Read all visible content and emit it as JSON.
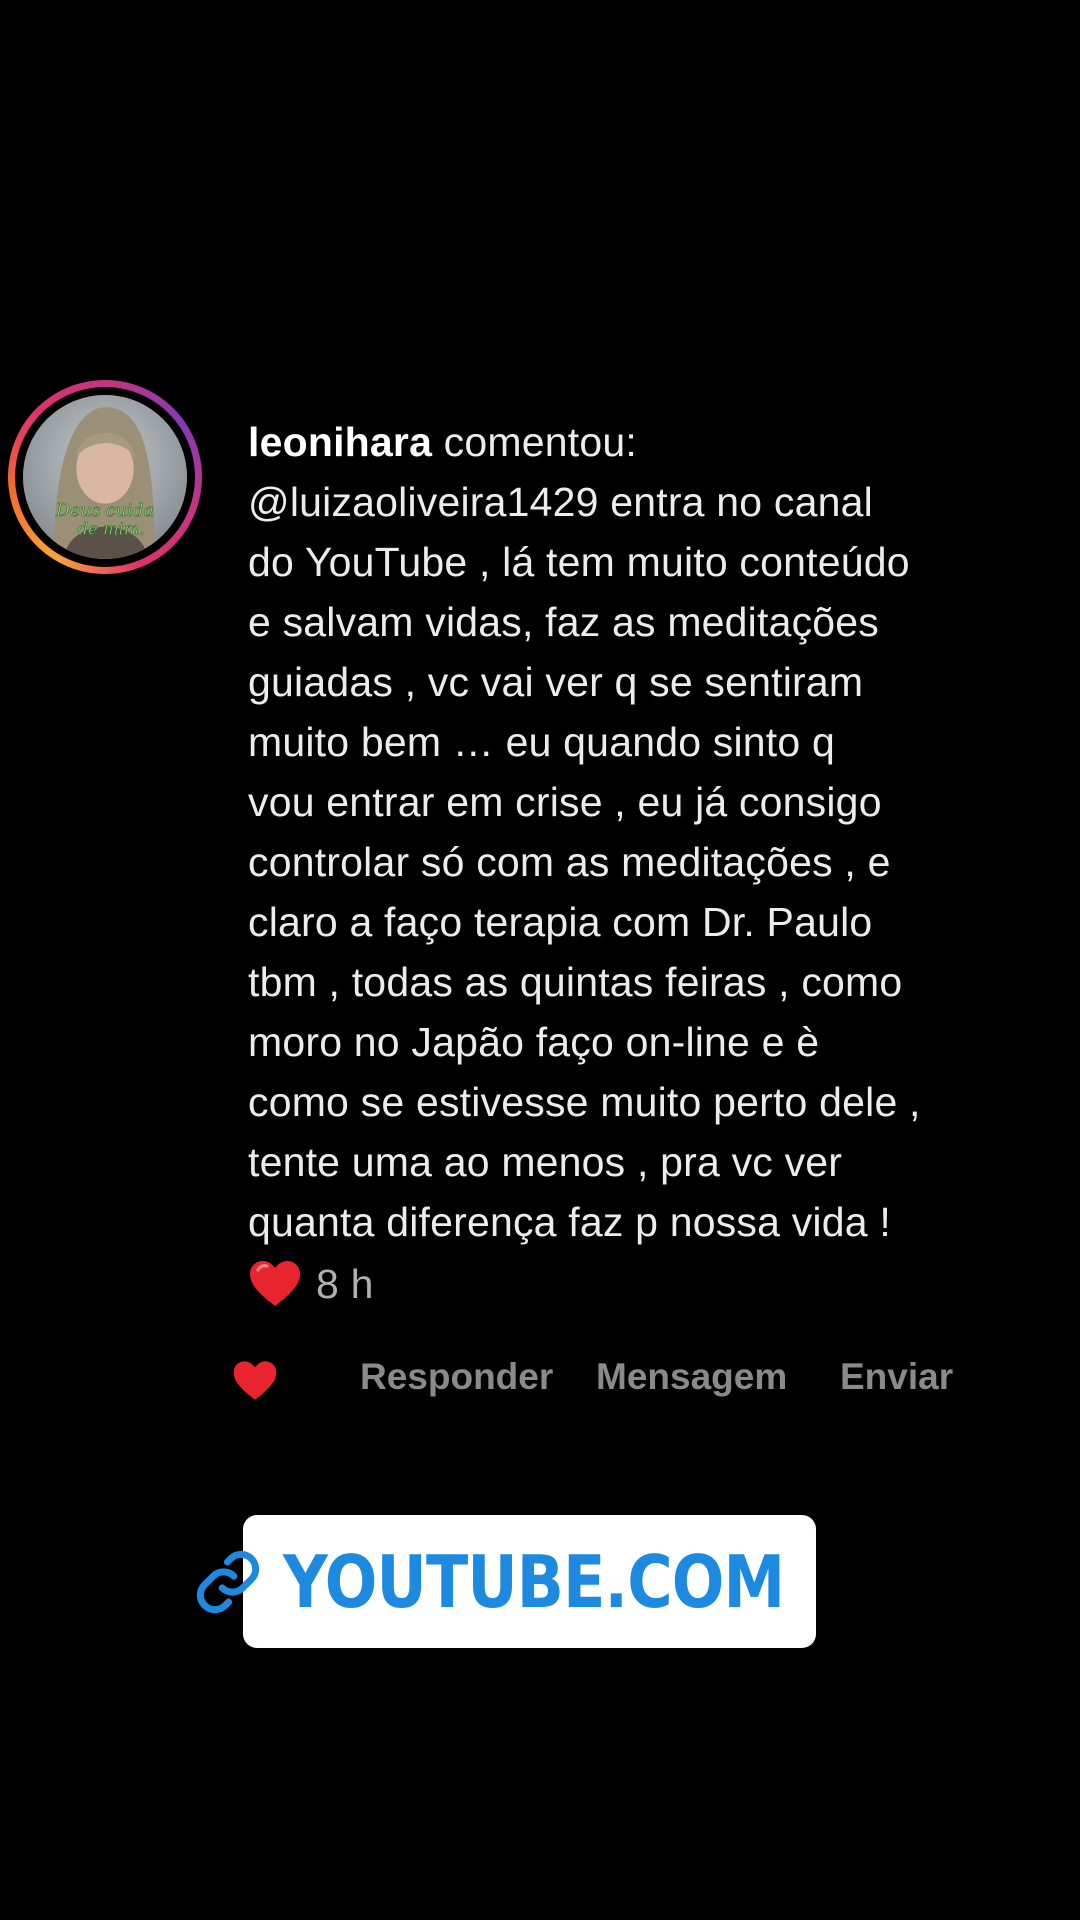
{
  "comment": {
    "avatar_caption": "Deus cuida de mim.",
    "username": "leonihara",
    "verb": " comentou:",
    "body": "@luizaoliveira1429 entra no canal\ndo YouTube , lá tem muito conteúdo\ne salvam vidas, faz as meditações\nguiadas , vc vai ver q se sentiram\nmuito bem … eu quando sinto q\nvou entrar em crise , eu já consigo\ncontrolar só com as meditações , e\nclaro a faço terapia com Dr. Paulo\ntbm , todas as quintas feiras , como\nmoro no Japão faço on-line e è\ncomo se estivesse muito perto dele ,\ntente uma ao menos , pra vc ver\nquanta diferença faz p nossa vida !",
    "timestamp": "8 h"
  },
  "actions": {
    "reply_label": "Responder",
    "message_label": "Mensagem",
    "send_label": "Enviar"
  },
  "link_sticker": {
    "label": "YOUTUBE.COM",
    "icon": "link-icon"
  },
  "colors": {
    "background": "#000000",
    "heart": "#e8252f",
    "link_text": "#1d8ae0",
    "action_text": "#8a8a8a"
  }
}
